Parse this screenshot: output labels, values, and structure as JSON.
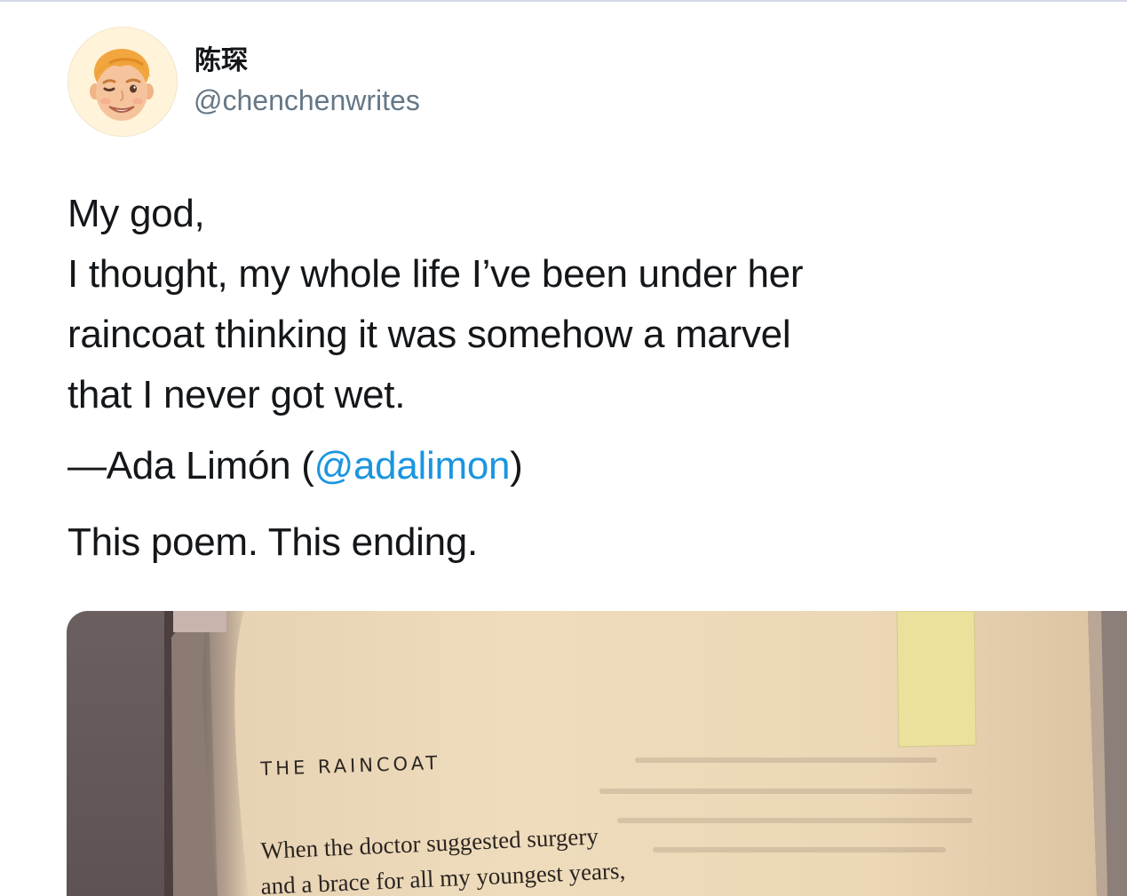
{
  "user": {
    "display_name": "陈琛",
    "handle": "@chenchenwrites",
    "avatar_icon": "memoji-avatar-icon"
  },
  "tweet": {
    "lines": [
      "My god,",
      "I thought, my whole life I’ve been under her",
      "raincoat thinking it was somehow a marvel",
      "that I never got wet."
    ],
    "attribution": {
      "prefix": "—Ada Limón (",
      "mention": "@adalimon",
      "suffix": ")"
    },
    "comment": "This poem. This ending."
  },
  "media": {
    "poem_title": "THE RAINCOAT",
    "poem_lines": [
      "When the doctor suggested surgery",
      "and a brace for all my youngest years,"
    ]
  },
  "colors": {
    "link": "#1b95e0",
    "handle": "#657786",
    "text": "#14171a",
    "page_paper": "#eedcbd"
  }
}
